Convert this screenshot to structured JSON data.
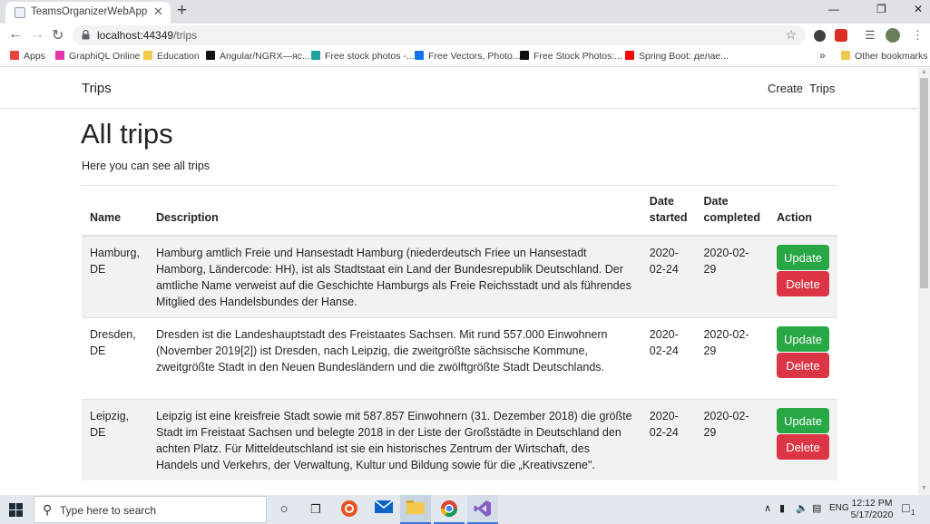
{
  "browser": {
    "tab_title": "TeamsOrganizerWebApp",
    "url_host": "localhost:44349",
    "url_path": "/trips",
    "bookmarks": [
      {
        "label": "Apps",
        "icon": "apps-grid-icon",
        "color": "#e8453c"
      },
      {
        "label": "GraphiQL Online",
        "icon": "graphql-icon",
        "color": "#e535ab"
      },
      {
        "label": "Education",
        "icon": "folder-icon",
        "color": "#f2c94c"
      },
      {
        "label": "Angular/NGRX—яс...",
        "icon": "medium-icon",
        "color": "#111111"
      },
      {
        "label": "Free stock photos -...",
        "icon": "stock-photo-icon",
        "color": "#20a39e"
      },
      {
        "label": "Free Vectors, Photo...",
        "icon": "freepik-icon",
        "color": "#1273eb"
      },
      {
        "label": "Free Stock Photos:...",
        "icon": "b-letter-icon",
        "color": "#111111"
      },
      {
        "label": "Spring Boot: делае...",
        "icon": "youtube-icon",
        "color": "#ff0000"
      }
    ],
    "overflow_label": "»",
    "other_bookmarks": "Other bookmarks"
  },
  "app": {
    "brand": "Trips",
    "nav": {
      "create": "Create",
      "trips": "Trips"
    },
    "title": "All trips",
    "subtitle": "Here you can see all trips"
  },
  "table": {
    "headers": {
      "name": "Name",
      "description": "Description",
      "date_started": "Date started",
      "date_completed": "Date completed",
      "action": "Action"
    },
    "update_label": "Update",
    "delete_label": "Delete",
    "rows": [
      {
        "name": "Hamburg, DE",
        "description": "Hamburg amtlich Freie und Hansestadt Hamburg (niederdeutsch Friee un Hansestadt Hamborg, Ländercode: HH), ist als Stadtstaat ein Land der Bundesrepublik Deutschland. Der amtliche Name verweist auf die Geschichte Hamburgs als Freie Reichsstadt und als führendes Mitglied des Handelsbundes der Hanse.",
        "date_started": "2020-02-24",
        "date_completed": "2020-02-29"
      },
      {
        "name": "Dresden, DE",
        "description": "Dresden ist die Landeshauptstadt des Freistaates Sachsen. Mit rund 557.000 Einwohnern (November 2019[2]) ist Dresden, nach Leipzig, die zweitgrößte sächsische Kommune, zweitgrößte Stadt in den Neuen Bundesländern und die zwölftgrößte Stadt Deutschlands.",
        "date_started": "2020-02-24",
        "date_completed": "2020-02-29"
      },
      {
        "name": "Leipzig, DE",
        "description": "Leipzig ist eine kreisfreie Stadt sowie mit 587.857 Einwohnern (31. Dezember 2018) die größte Stadt im Freistaat Sachsen und belegte 2018 in der Liste der Großstädte in Deutschland den achten Platz. Für Mitteldeutschland ist sie ein historisches Zentrum der Wirtschaft, des Handels und Verkehrs, der Verwaltung, Kultur und Bildung sowie für die „Kreativszene\".",
        "date_started": "2020-02-24",
        "date_completed": "2020-02-29"
      }
    ]
  },
  "taskbar": {
    "search_placeholder": "Type here to search",
    "language": "ENG",
    "time": "12:12 PM",
    "date": "5/17/2020",
    "notification_count": "1"
  }
}
